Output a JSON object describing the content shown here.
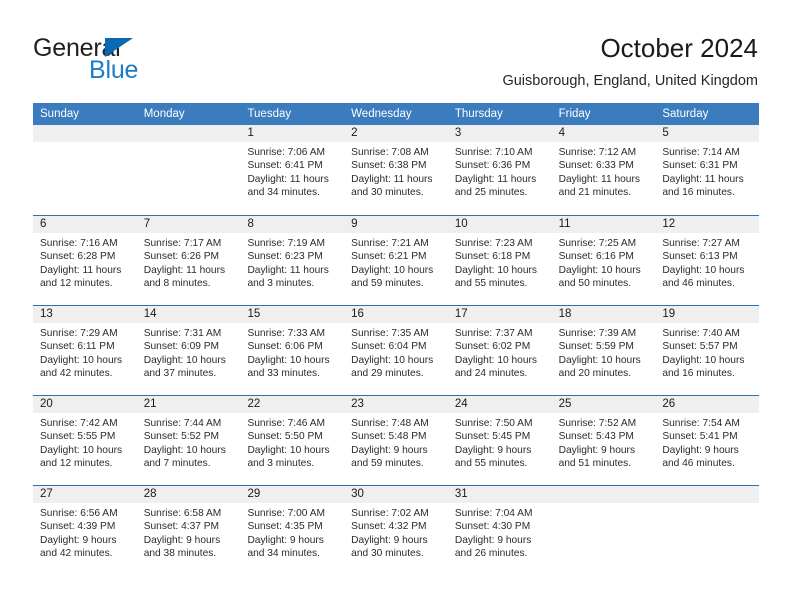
{
  "brand": {
    "name_part1": "General",
    "name_part2": "Blue",
    "triangle_icon": "brand-triangle-icon",
    "accent_color": "#1f7cc4",
    "triangle_color": "#0a69b0"
  },
  "header": {
    "title": "October 2024",
    "subtitle": "Guisborough, England, United Kingdom"
  },
  "calendar": {
    "header_bg": "#3a7cbe",
    "row_divider_color": "#2f6fad",
    "day_band_bg": "#efefef",
    "weekdays": [
      "Sunday",
      "Monday",
      "Tuesday",
      "Wednesday",
      "Thursday",
      "Friday",
      "Saturday"
    ],
    "weeks": [
      [
        {
          "day": "",
          "empty": true,
          "sunrise": "",
          "sunset": "",
          "daylight": ""
        },
        {
          "day": "",
          "empty": true,
          "sunrise": "",
          "sunset": "",
          "daylight": ""
        },
        {
          "day": "1",
          "sunrise": "Sunrise: 7:06 AM",
          "sunset": "Sunset: 6:41 PM",
          "daylight": "Daylight: 11 hours and 34 minutes."
        },
        {
          "day": "2",
          "sunrise": "Sunrise: 7:08 AM",
          "sunset": "Sunset: 6:38 PM",
          "daylight": "Daylight: 11 hours and 30 minutes."
        },
        {
          "day": "3",
          "sunrise": "Sunrise: 7:10 AM",
          "sunset": "Sunset: 6:36 PM",
          "daylight": "Daylight: 11 hours and 25 minutes."
        },
        {
          "day": "4",
          "sunrise": "Sunrise: 7:12 AM",
          "sunset": "Sunset: 6:33 PM",
          "daylight": "Daylight: 11 hours and 21 minutes."
        },
        {
          "day": "5",
          "sunrise": "Sunrise: 7:14 AM",
          "sunset": "Sunset: 6:31 PM",
          "daylight": "Daylight: 11 hours and 16 minutes."
        }
      ],
      [
        {
          "day": "6",
          "sunrise": "Sunrise: 7:16 AM",
          "sunset": "Sunset: 6:28 PM",
          "daylight": "Daylight: 11 hours and 12 minutes."
        },
        {
          "day": "7",
          "sunrise": "Sunrise: 7:17 AM",
          "sunset": "Sunset: 6:26 PM",
          "daylight": "Daylight: 11 hours and 8 minutes."
        },
        {
          "day": "8",
          "sunrise": "Sunrise: 7:19 AM",
          "sunset": "Sunset: 6:23 PM",
          "daylight": "Daylight: 11 hours and 3 minutes."
        },
        {
          "day": "9",
          "sunrise": "Sunrise: 7:21 AM",
          "sunset": "Sunset: 6:21 PM",
          "daylight": "Daylight: 10 hours and 59 minutes."
        },
        {
          "day": "10",
          "sunrise": "Sunrise: 7:23 AM",
          "sunset": "Sunset: 6:18 PM",
          "daylight": "Daylight: 10 hours and 55 minutes."
        },
        {
          "day": "11",
          "sunrise": "Sunrise: 7:25 AM",
          "sunset": "Sunset: 6:16 PM",
          "daylight": "Daylight: 10 hours and 50 minutes."
        },
        {
          "day": "12",
          "sunrise": "Sunrise: 7:27 AM",
          "sunset": "Sunset: 6:13 PM",
          "daylight": "Daylight: 10 hours and 46 minutes."
        }
      ],
      [
        {
          "day": "13",
          "sunrise": "Sunrise: 7:29 AM",
          "sunset": "Sunset: 6:11 PM",
          "daylight": "Daylight: 10 hours and 42 minutes."
        },
        {
          "day": "14",
          "sunrise": "Sunrise: 7:31 AM",
          "sunset": "Sunset: 6:09 PM",
          "daylight": "Daylight: 10 hours and 37 minutes."
        },
        {
          "day": "15",
          "sunrise": "Sunrise: 7:33 AM",
          "sunset": "Sunset: 6:06 PM",
          "daylight": "Daylight: 10 hours and 33 minutes."
        },
        {
          "day": "16",
          "sunrise": "Sunrise: 7:35 AM",
          "sunset": "Sunset: 6:04 PM",
          "daylight": "Daylight: 10 hours and 29 minutes."
        },
        {
          "day": "17",
          "sunrise": "Sunrise: 7:37 AM",
          "sunset": "Sunset: 6:02 PM",
          "daylight": "Daylight: 10 hours and 24 minutes."
        },
        {
          "day": "18",
          "sunrise": "Sunrise: 7:39 AM",
          "sunset": "Sunset: 5:59 PM",
          "daylight": "Daylight: 10 hours and 20 minutes."
        },
        {
          "day": "19",
          "sunrise": "Sunrise: 7:40 AM",
          "sunset": "Sunset: 5:57 PM",
          "daylight": "Daylight: 10 hours and 16 minutes."
        }
      ],
      [
        {
          "day": "20",
          "sunrise": "Sunrise: 7:42 AM",
          "sunset": "Sunset: 5:55 PM",
          "daylight": "Daylight: 10 hours and 12 minutes."
        },
        {
          "day": "21",
          "sunrise": "Sunrise: 7:44 AM",
          "sunset": "Sunset: 5:52 PM",
          "daylight": "Daylight: 10 hours and 7 minutes."
        },
        {
          "day": "22",
          "sunrise": "Sunrise: 7:46 AM",
          "sunset": "Sunset: 5:50 PM",
          "daylight": "Daylight: 10 hours and 3 minutes."
        },
        {
          "day": "23",
          "sunrise": "Sunrise: 7:48 AM",
          "sunset": "Sunset: 5:48 PM",
          "daylight": "Daylight: 9 hours and 59 minutes."
        },
        {
          "day": "24",
          "sunrise": "Sunrise: 7:50 AM",
          "sunset": "Sunset: 5:45 PM",
          "daylight": "Daylight: 9 hours and 55 minutes."
        },
        {
          "day": "25",
          "sunrise": "Sunrise: 7:52 AM",
          "sunset": "Sunset: 5:43 PM",
          "daylight": "Daylight: 9 hours and 51 minutes."
        },
        {
          "day": "26",
          "sunrise": "Sunrise: 7:54 AM",
          "sunset": "Sunset: 5:41 PM",
          "daylight": "Daylight: 9 hours and 46 minutes."
        }
      ],
      [
        {
          "day": "27",
          "sunrise": "Sunrise: 6:56 AM",
          "sunset": "Sunset: 4:39 PM",
          "daylight": "Daylight: 9 hours and 42 minutes."
        },
        {
          "day": "28",
          "sunrise": "Sunrise: 6:58 AM",
          "sunset": "Sunset: 4:37 PM",
          "daylight": "Daylight: 9 hours and 38 minutes."
        },
        {
          "day": "29",
          "sunrise": "Sunrise: 7:00 AM",
          "sunset": "Sunset: 4:35 PM",
          "daylight": "Daylight: 9 hours and 34 minutes."
        },
        {
          "day": "30",
          "sunrise": "Sunrise: 7:02 AM",
          "sunset": "Sunset: 4:32 PM",
          "daylight": "Daylight: 9 hours and 30 minutes."
        },
        {
          "day": "31",
          "sunrise": "Sunrise: 7:04 AM",
          "sunset": "Sunset: 4:30 PM",
          "daylight": "Daylight: 9 hours and 26 minutes."
        },
        {
          "day": "",
          "empty": true,
          "sunrise": "",
          "sunset": "",
          "daylight": ""
        },
        {
          "day": "",
          "empty": true,
          "sunrise": "",
          "sunset": "",
          "daylight": ""
        }
      ]
    ]
  }
}
